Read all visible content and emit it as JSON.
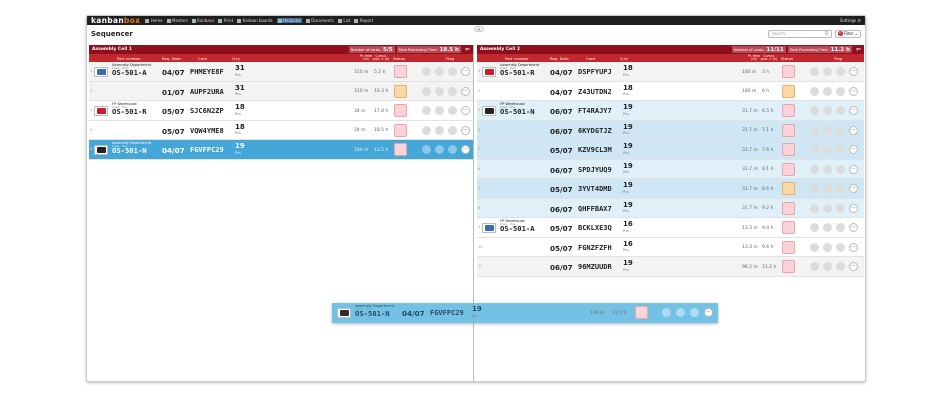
{
  "nav": {
    "logo_a": "kanban",
    "logo_b": "box",
    "items": [
      "Home",
      "Masters",
      "Kanbans",
      "Print",
      "Kanban boards",
      "Heijunka",
      "Documents",
      "List",
      "Report"
    ],
    "settings": "Settings ⚙"
  },
  "page": {
    "title": "Sequencer"
  },
  "search": {
    "placeholder": "search..."
  },
  "filter": {
    "label": "Filter",
    "count": "0"
  },
  "left": {
    "cell_name": "Assembly Cell 1",
    "cards_label": "Number of cards:",
    "cards_value": "5/5",
    "time_label": "Total Processing Time:",
    "time_value": "18.5 h"
  },
  "right": {
    "cell_name": "Assembly Cell 2",
    "cards_label": "Number of cards:",
    "cards_value": "11/11",
    "time_label": "Total Processing Time:",
    "time_value": "11.2 h"
  },
  "headers": {
    "part": "Part number",
    "date": "Req. Date",
    "card": "Card",
    "qty": "Q.ty",
    "ptime": "Pr. time (m)",
    "cum": "Cumul. proc. t. (h)",
    "status": "Status",
    "flag": "Flag"
  },
  "left_rows": [
    {
      "num": "1",
      "src": "Assembly Department",
      "sub": "Case · Pos",
      "part": "OS-501-A",
      "date": "04/07",
      "card": "PHMEYE8F",
      "qty": "31",
      "pcs": "Pcs",
      "ptime": "310 m",
      "cum": "5.2 h",
      "status": "pink",
      "thumb": "#3b6db4",
      "style": "alt"
    },
    {
      "num": "2",
      "src": "",
      "sub": "",
      "part": "",
      "date": "01/07",
      "card": "AUPF2URA",
      "qty": "31",
      "pcs": "Pcs",
      "ptime": "310 m",
      "cum": "10.3 h",
      "status": "orange",
      "thumb": "",
      "style": "alt"
    },
    {
      "num": "3",
      "src": "FP Warehouse",
      "sub": "Case · Pos",
      "part": "OS-501-R",
      "date": "05/07",
      "card": "SJC6N2ZP",
      "qty": "18",
      "pcs": "Pcs",
      "ptime": "34 m",
      "cum": "17.8 h",
      "status": "pink",
      "thumb": "#c81e2e",
      "style": ""
    },
    {
      "num": "4",
      "src": "",
      "sub": "",
      "part": "",
      "date": "05/07",
      "card": "VQW4YME8",
      "qty": "18",
      "pcs": "Pcs",
      "ptime": "34 m",
      "cum": "18.5 h",
      "status": "pink",
      "thumb": "",
      "style": ""
    },
    {
      "num": "5",
      "src": "Assembly Department",
      "sub": "Case · Pos",
      "part": "OS-501-N",
      "date": "04/07",
      "card": "FGVFPC29",
      "qty": "19",
      "pcs": "Pcs",
      "ptime": "190 m",
      "cum": "13.5 h",
      "status": "pink",
      "thumb": "#222222",
      "style": "sel"
    }
  ],
  "right_rows": [
    {
      "num": "1",
      "src": "Assembly Department",
      "sub": "Case · Pos",
      "part": "OS-501-R",
      "date": "04/07",
      "card": "DSPFYUPJ",
      "qty": "18",
      "pcs": "Pcs",
      "ptime": "180 m",
      "cum": "3 h",
      "status": "pink",
      "thumb": "#c81e2e",
      "style": "alt"
    },
    {
      "num": "2",
      "src": "",
      "sub": "",
      "part": "",
      "date": "04/07",
      "card": "Z43UTDN2",
      "qty": "18",
      "pcs": "Pcs",
      "ptime": "180 m",
      "cum": "6 h",
      "status": "orange",
      "thumb": "",
      "style": ""
    },
    {
      "num": "3",
      "src": "FP Warehouse",
      "sub": "Case · Pos",
      "part": "OS-501-N",
      "date": "06/07",
      "card": "FT4RAJY7",
      "qty": "19",
      "pcs": "Pcs",
      "ptime": "31.7 m",
      "cum": "6.5 h",
      "status": "pink",
      "thumb": "#222222",
      "style": "lblue"
    },
    {
      "num": "4",
      "src": "",
      "sub": "",
      "part": "",
      "date": "06/07",
      "card": "6KYDGTJZ",
      "qty": "19",
      "pcs": "Pcs",
      "ptime": "31.7 m",
      "cum": "7.1 h",
      "status": "pink",
      "thumb": "",
      "style": "lblue2"
    },
    {
      "num": "5",
      "src": "",
      "sub": "",
      "part": "",
      "date": "05/07",
      "card": "KZV9CL3M",
      "qty": "19",
      "pcs": "Pcs",
      "ptime": "31.7 m",
      "cum": "7.6 h",
      "status": "pink",
      "thumb": "",
      "style": "lblue2"
    },
    {
      "num": "6",
      "src": "",
      "sub": "",
      "part": "",
      "date": "06/07",
      "card": "SPDJYUQ9",
      "qty": "19",
      "pcs": "Pcs",
      "ptime": "31.7 m",
      "cum": "8.1 h",
      "status": "pink",
      "thumb": "",
      "style": "lblue"
    },
    {
      "num": "7",
      "src": "",
      "sub": "",
      "part": "",
      "date": "05/07",
      "card": "3YVT4DMD",
      "qty": "19",
      "pcs": "Pcs",
      "ptime": "31.7 m",
      "cum": "8.6 h",
      "status": "orange",
      "thumb": "",
      "style": "lblue2"
    },
    {
      "num": "8",
      "src": "",
      "sub": "",
      "part": "",
      "date": "06/07",
      "card": "QHFFBAX7",
      "qty": "19",
      "pcs": "Pcs",
      "ptime": "31.7 m",
      "cum": "9.2 h",
      "status": "pink",
      "thumb": "",
      "style": "lblue"
    },
    {
      "num": "9",
      "src": "FP Warehouse",
      "sub": "Case · Pos",
      "part": "OS-501-A",
      "date": "05/07",
      "card": "BCKLXE3Q",
      "qty": "16",
      "pcs": "Pcs",
      "ptime": "13.3 m",
      "cum": "9.4 h",
      "status": "pink",
      "thumb": "#3b6db4",
      "style": ""
    },
    {
      "num": "10",
      "src": "",
      "sub": "",
      "part": "",
      "date": "05/07",
      "card": "FGNZFZFH",
      "qty": "16",
      "pcs": "Pcs",
      "ptime": "13.3 m",
      "cum": "9.6 h",
      "status": "pink",
      "thumb": "",
      "style": ""
    },
    {
      "num": "11",
      "src": "",
      "sub": "",
      "part": "",
      "date": "06/07",
      "card": "96MZUUDR",
      "qty": "19",
      "pcs": "Pcs",
      "ptime": "98.2 m",
      "cum": "11.2 h",
      "status": "pink",
      "thumb": "",
      "style": "alt"
    }
  ],
  "ghost": {
    "src": "Assembly Department",
    "sub": "Case · Pos",
    "part": "OS-501-N",
    "date": "04/07",
    "card": "FGVFPC29",
    "qty": "19",
    "pcs": "Pcs",
    "ptime": "190 m",
    "cum": "13.5 h",
    "status": "pink",
    "thumb": "#222222"
  }
}
